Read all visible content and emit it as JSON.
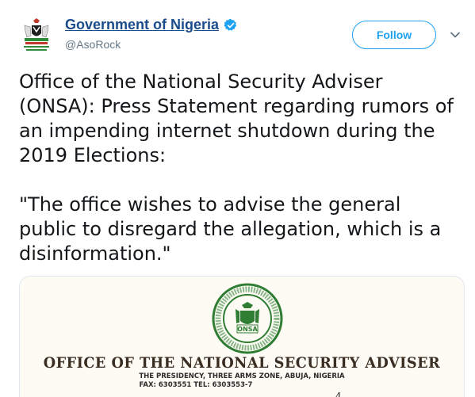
{
  "author": {
    "display_name": "Government of Nigeria",
    "handle": "@AsoRock",
    "verified": true
  },
  "actions": {
    "follow_label": "Follow"
  },
  "tweet": {
    "paragraph1": "Office of the National Security Adviser (ONSA): Press Statement regarding rumors of an impending internet shutdown during the 2019 Elections:",
    "paragraph2": "\"The office wishes to advise the general public to disregard the allegation, which is a disinformation.\""
  },
  "media": {
    "letterhead_title": "OFFICE OF THE NATIONAL SECURITY ADVISER",
    "letterhead_line1": "THE PRESIDENCY, THREE ARMS ZONE, ABUJA, NIGERIA",
    "letterhead_line2": "FAX: 6303551 TEL: 6303553-7",
    "seal_text": "ONSA",
    "partial_date": "4"
  },
  "colors": {
    "name_link": "#1a4c8c",
    "accent": "#1da1f2",
    "secondary_text": "#657786"
  },
  "icons": [
    "coat-of-arms-icon",
    "verified-badge-icon",
    "chevron-down-icon",
    "onsa-seal-icon"
  ]
}
